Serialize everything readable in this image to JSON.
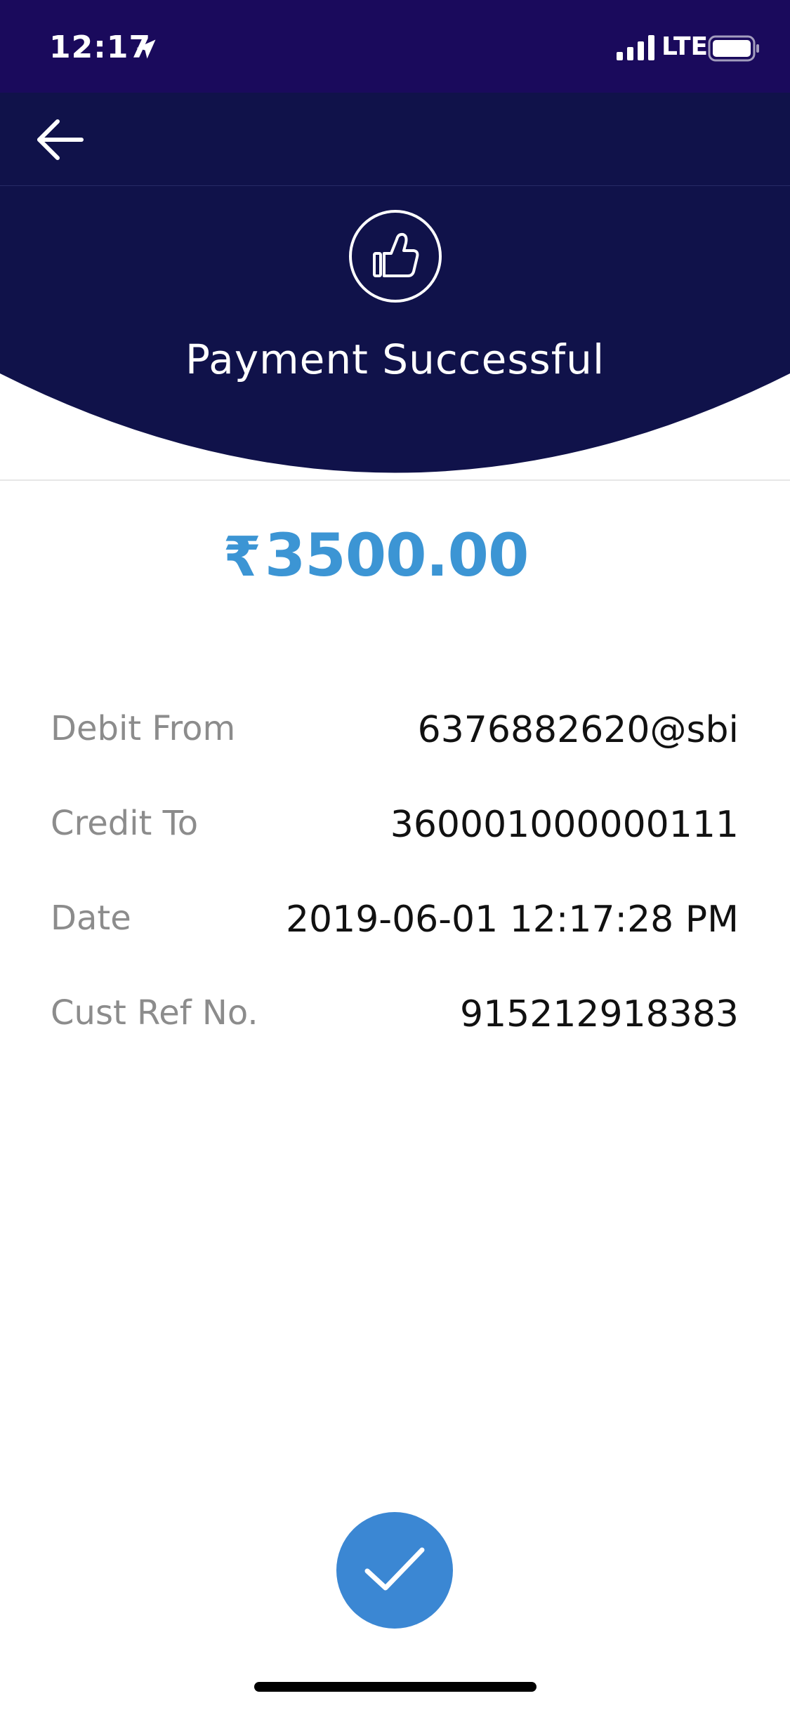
{
  "status_bar": {
    "time": "12:17",
    "network": "LTE",
    "icons": [
      "location-arrow-icon",
      "signal-icon",
      "battery-icon"
    ]
  },
  "nav": {
    "back_icon": "back-arrow-icon"
  },
  "header": {
    "icon": "thumbs-up-icon",
    "title": "Payment Successful"
  },
  "amount": {
    "currency": "₹",
    "value": "3500.00"
  },
  "details": [
    {
      "label": "Debit From",
      "value": "6376882620@sbi"
    },
    {
      "label": "Credit To",
      "value": "360001000000111"
    },
    {
      "label": "Date",
      "value": "2019-06-01 12:17:28 PM"
    },
    {
      "label": "Cust Ref No.",
      "value": "915212918383"
    }
  ],
  "confirm": {
    "icon": "checkmark-icon"
  },
  "colors": {
    "status_bar_bg": "#1a0a5c",
    "header_bg": "#10124a",
    "amount": "#3c95d4",
    "button": "#3b87d3",
    "label": "#8c8c8c",
    "value": "#111111"
  }
}
